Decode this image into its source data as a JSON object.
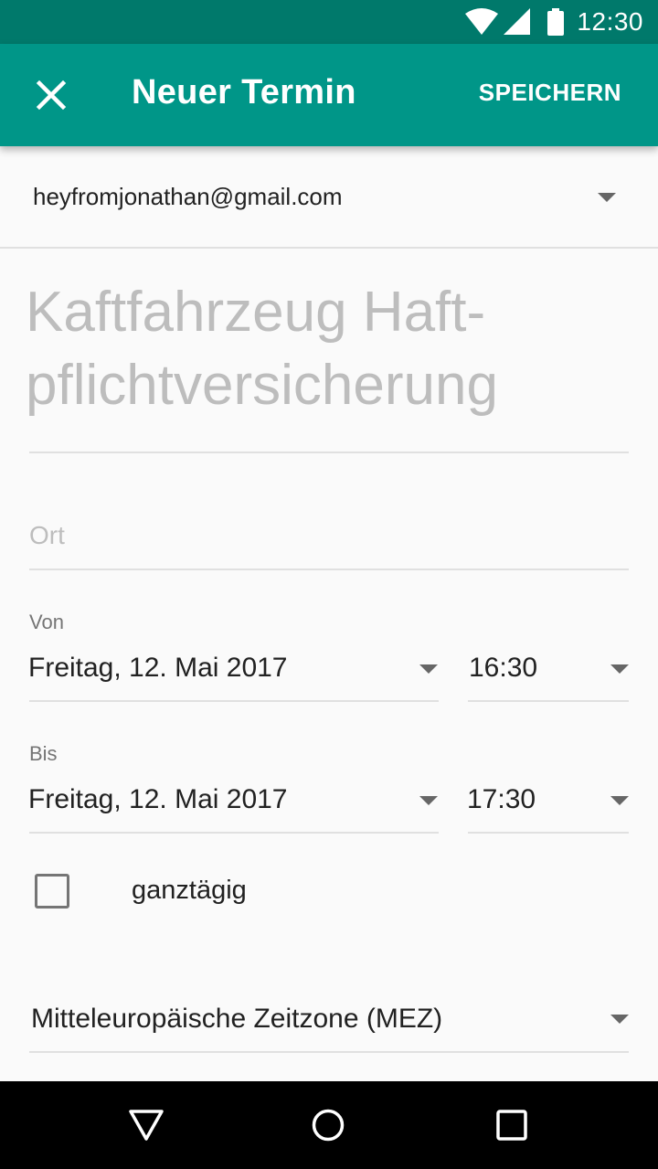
{
  "status_bar": {
    "time": "12:30",
    "icons": [
      "wifi-icon",
      "signal-icon",
      "battery-icon"
    ]
  },
  "app_bar": {
    "title": "Neuer Termin",
    "save_label": "SPEICHERN",
    "close_icon": "close-icon"
  },
  "account": {
    "email": "heyfromjonathan@gmail.com"
  },
  "event": {
    "title": "Kaftfahrzeug Haft-pflichtversicherung",
    "location_placeholder": "Ort"
  },
  "from": {
    "label": "Von",
    "date": "Freitag, 12. Mai 2017",
    "time": "16:30"
  },
  "to": {
    "label": "Bis",
    "date": "Freitag, 12. Mai 2017",
    "time": "17:30"
  },
  "all_day": {
    "label": "ganztägig",
    "checked": false
  },
  "timezone": {
    "value": "Mitteleuropäische Zeitzone (MEZ)"
  },
  "nav": {
    "icons": [
      "back-icon",
      "home-icon",
      "recents-icon"
    ]
  },
  "colors": {
    "primary": "#009688",
    "primary_dark": "#00796b"
  }
}
